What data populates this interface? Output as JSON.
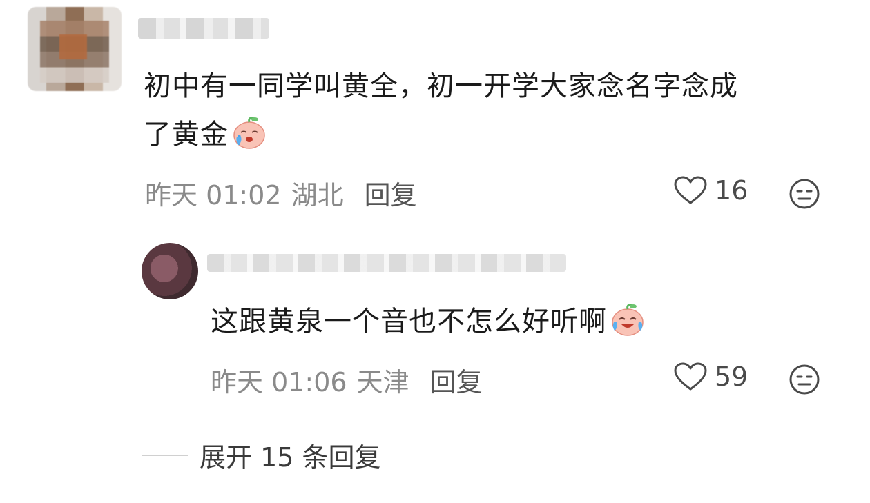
{
  "comment": {
    "text_line1": "初中有一同学叫黄全，初一开学大家念名字念成",
    "text_line2": "了黄金",
    "time": "昨天 01:02",
    "location": "湖北",
    "reply_label": "回复",
    "like_count": "16"
  },
  "reply": {
    "text": "这跟黄泉一个音也不怎么好听啊",
    "time": "昨天 01:06",
    "location": "天津",
    "reply_label": "回复",
    "like_count": "59"
  },
  "expand": {
    "label": "展开 15 条回复"
  },
  "icons": {
    "like": "heart-outline-icon",
    "dislike": "neutral-face-icon",
    "emoji_main": "crying-emoji",
    "emoji_reply": "laugh-crying-emoji"
  },
  "colors": {
    "meta_gray": "#8a8a8a",
    "text": "#1a1a1a",
    "emoji_pink": "#f7b0a7"
  }
}
